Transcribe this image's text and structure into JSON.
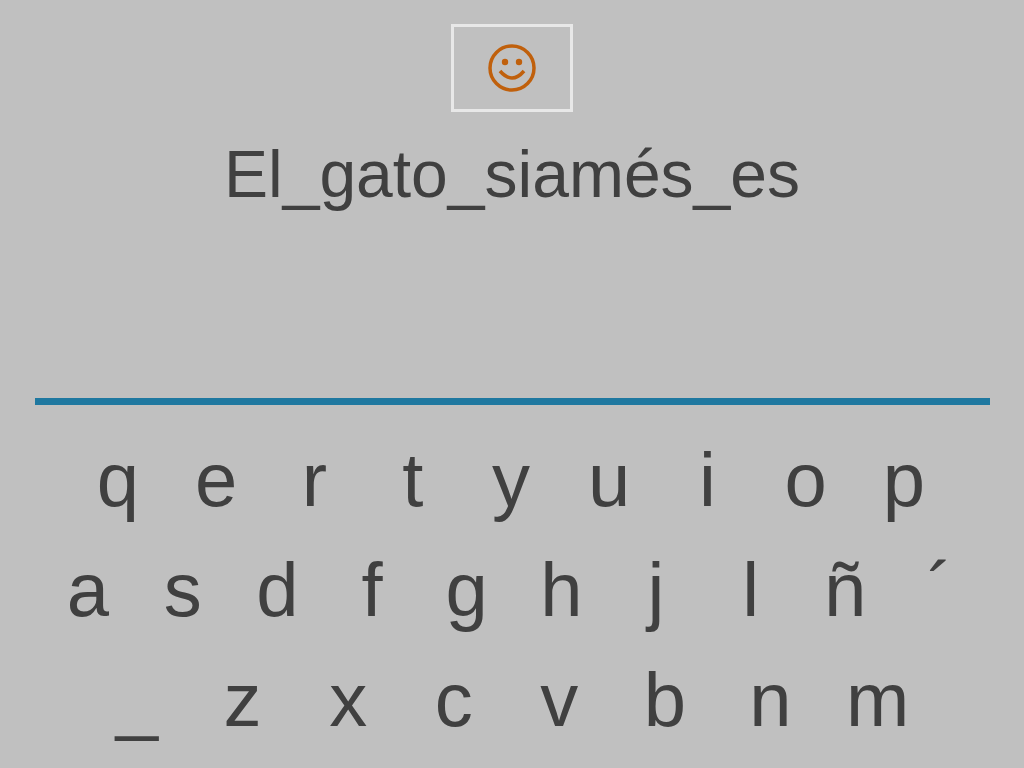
{
  "phrase": "El_gato_siamés_es",
  "keyboard": {
    "rows": [
      [
        "q",
        "e",
        "r",
        "t",
        "y",
        "u",
        "i",
        "o",
        "p"
      ],
      [
        "a",
        "s",
        "d",
        "f",
        "g",
        "h",
        "j",
        "l",
        "ñ",
        "´"
      ],
      [
        "_",
        "z",
        "x",
        "c",
        "v",
        "b",
        "n",
        "m"
      ]
    ]
  }
}
